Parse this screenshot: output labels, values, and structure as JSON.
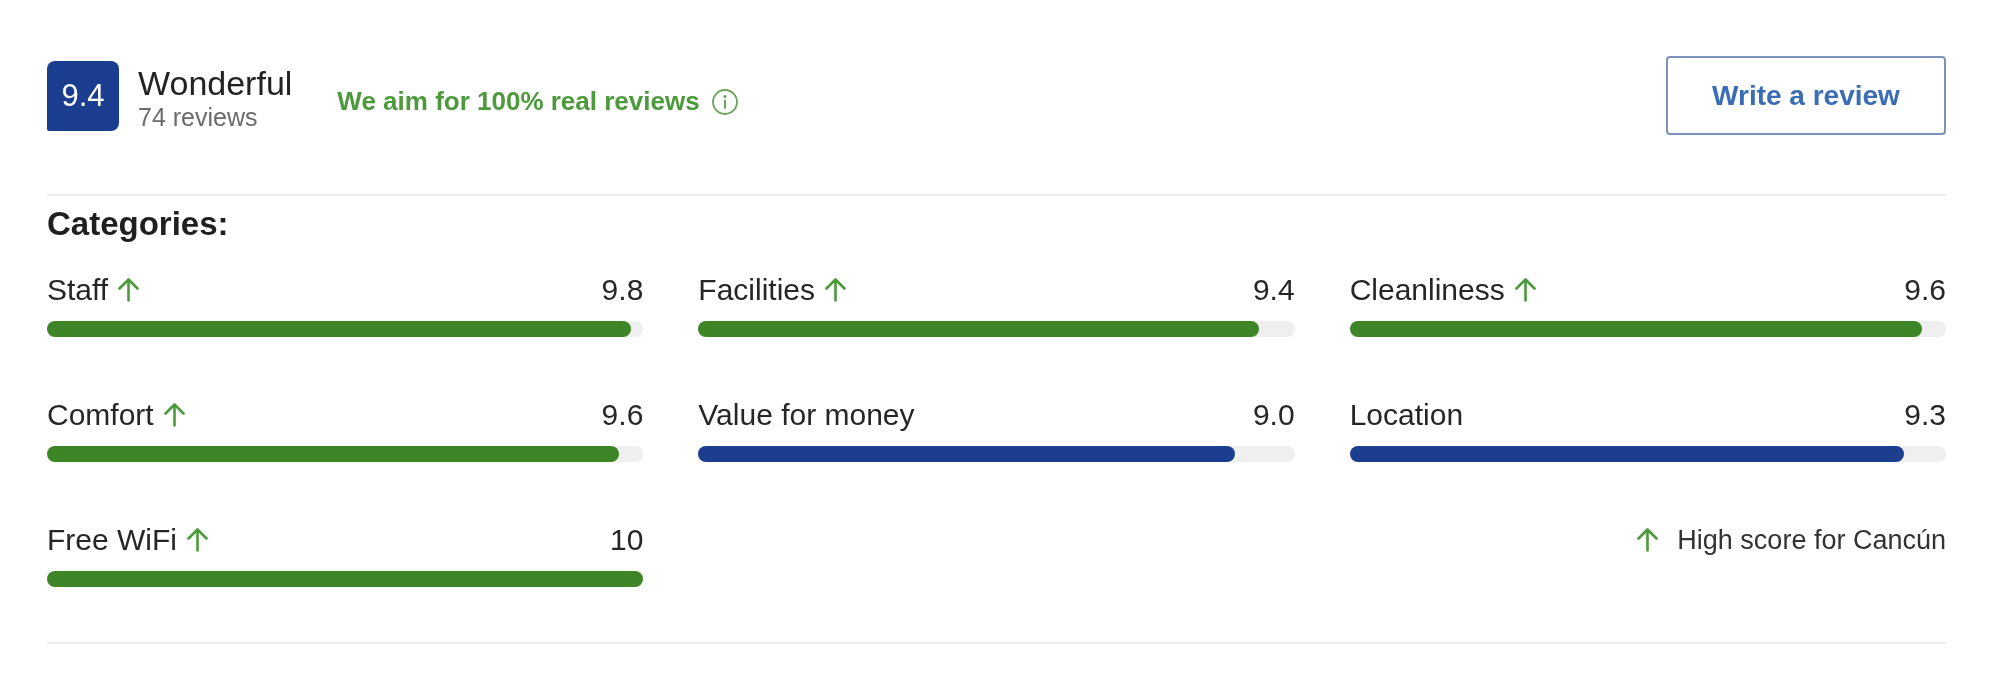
{
  "overall": {
    "score": "9.4",
    "rating": "Wonderful",
    "review_count": "74 reviews",
    "tagline": "We aim for 100% real reviews"
  },
  "write_review_button": "Write a review",
  "categories": {
    "title": "Categories:",
    "items": [
      {
        "name": "Staff",
        "score": "9.8",
        "level": 0.98,
        "high_score": true
      },
      {
        "name": "Facilities",
        "score": "9.4",
        "level": 0.94,
        "high_score": true
      },
      {
        "name": "Cleanliness",
        "score": "9.6",
        "level": 0.96,
        "high_score": true
      },
      {
        "name": "Comfort",
        "score": "9.6",
        "level": 0.96,
        "high_score": true
      },
      {
        "name": "Value for money",
        "score": "9.0",
        "level": 0.9,
        "high_score": false
      },
      {
        "name": "Location",
        "score": "9.3",
        "level": 0.93,
        "high_score": false
      },
      {
        "name": "Free WiFi",
        "score": "10",
        "level": 1.0,
        "high_score": true
      }
    ],
    "legend": "High score for Cancún"
  }
}
